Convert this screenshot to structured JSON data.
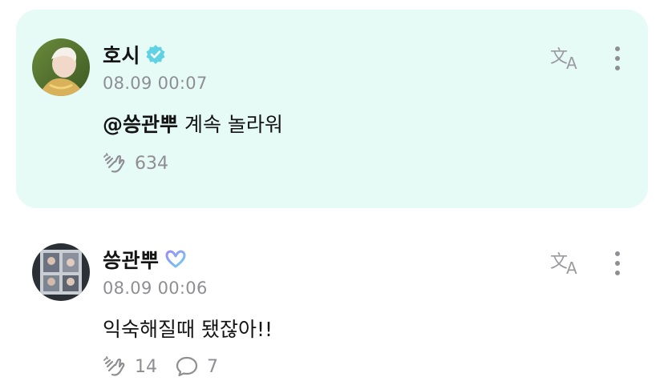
{
  "comments": [
    {
      "author": "호시",
      "verified_badge": "verified-check-icon",
      "badge_color": "#5fd3e3",
      "time": "08.09 00:07",
      "mention": "@씅관뿌",
      "text": " 계속 놀라워",
      "likes": "634",
      "highlight_color": "#e6faf6"
    },
    {
      "author": "씅관뿌",
      "membership_badge": "weverse-heart-icon",
      "time": "08.09 00:06",
      "text": "익숙해질때 됐잖아!!",
      "likes": "14",
      "replies": "7"
    }
  ],
  "icons": {
    "translate": "translate-icon",
    "more": "more-options-icon",
    "like": "clap-hand-icon",
    "reply": "speech-bubble-icon"
  }
}
